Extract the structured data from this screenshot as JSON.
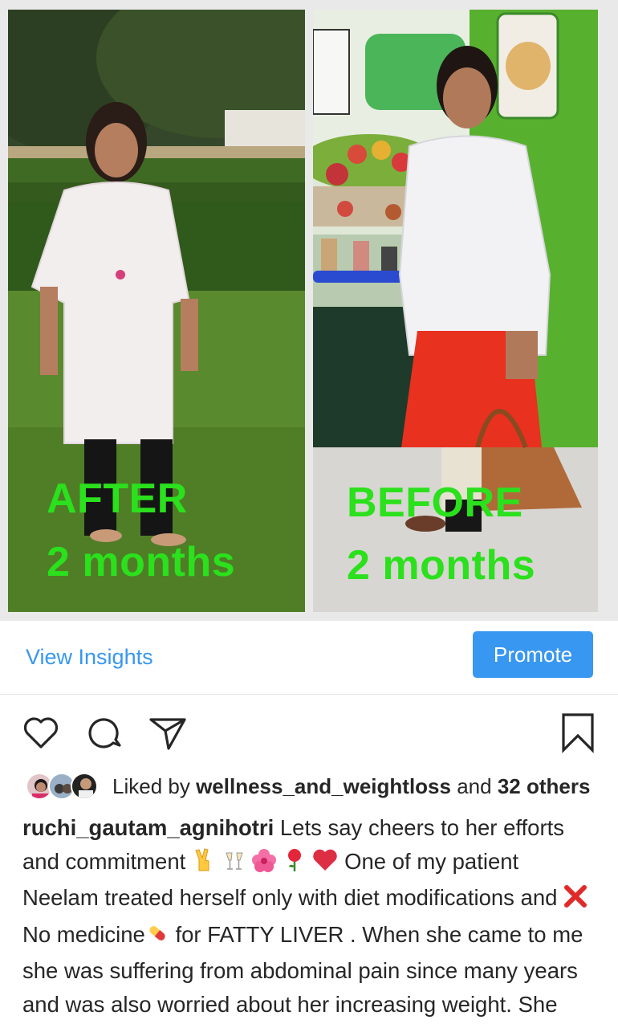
{
  "post": {
    "left_overlay": {
      "line1": "AFTER",
      "line2": "2 months"
    },
    "right_overlay": {
      "line1": "BEFORE",
      "line2": "2 months"
    }
  },
  "insights": {
    "view_insights_label": "View Insights",
    "promote_label": "Promote"
  },
  "actions": {
    "icons": [
      "heart-icon",
      "comment-icon",
      "share-icon",
      "bookmark-icon"
    ]
  },
  "likes": {
    "prefix": "Liked by",
    "user": "wellness_and_weightloss",
    "connector": "and",
    "others": "32 others"
  },
  "caption": {
    "username": "ruchi_gautam_agnihotri",
    "part1": " Lets say cheers to her efforts and commitment ",
    "part2": " One of my patient Neelam treated herself only with diet modifications and ",
    "part3": "No medicine",
    "part4": " for FATTY LIVER . When she came to me she was suffering from abdominal pain since many years and was also worried about her increasing weight. She Got"
  },
  "colors": {
    "link_blue": "#3897f0",
    "overlay_green": "#2be01c",
    "text": "#262626"
  }
}
